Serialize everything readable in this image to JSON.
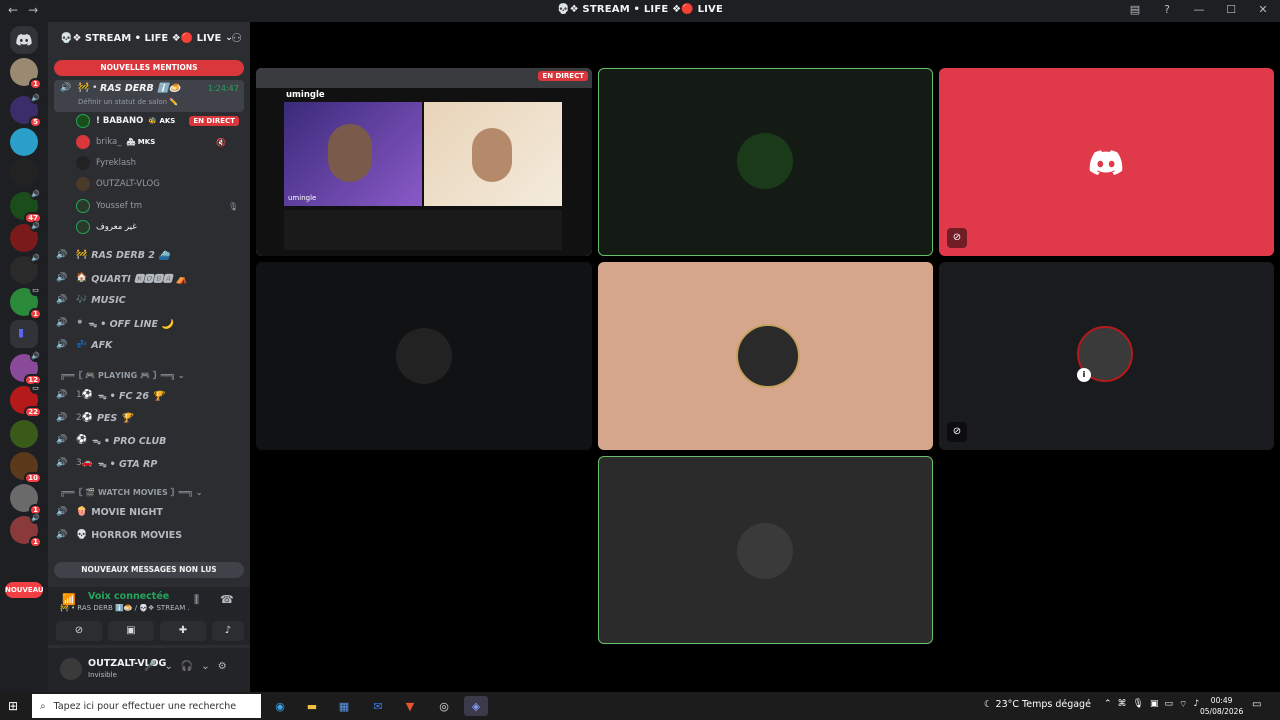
{
  "window": {
    "title": "💀❖ STREAM • LIFE ❖🔴 LIVE",
    "nav_back": "←",
    "nav_forward": "→",
    "inbox_icon": "inbox-icon",
    "help_icon": "help-icon"
  },
  "servers": [
    {
      "name": "home",
      "badge": ""
    },
    {
      "name": "server-1",
      "badge": "1"
    },
    {
      "name": "server-2",
      "badge": "5"
    },
    {
      "name": "server-3",
      "badge": ""
    },
    {
      "name": "server-4",
      "badge": ""
    },
    {
      "name": "server-5",
      "badge": "47"
    },
    {
      "name": "server-6",
      "badge": ""
    },
    {
      "name": "server-7",
      "badge": ""
    },
    {
      "name": "server-8",
      "badge": "1"
    },
    {
      "name": "folder",
      "badge": ""
    },
    {
      "name": "server-9",
      "badge": "12"
    },
    {
      "name": "server-10",
      "badge": "22"
    },
    {
      "name": "server-11",
      "badge": ""
    },
    {
      "name": "server-12",
      "badge": "10"
    },
    {
      "name": "server-13",
      "badge": "1"
    },
    {
      "name": "server-14",
      "badge": "1"
    }
  ],
  "new_pill": "NOUVEAU",
  "guild": {
    "name": "💀❖ STREAM • LIFE ❖🔴 LIVE",
    "mentions_pill": "NOUVELLES MENTIONS",
    "active_channel": {
      "name": "RAS DERB ℹ️🍮",
      "status": "Définir un statut de salon ✏️",
      "timer": "1:24:47"
    },
    "members": [
      {
        "name": "! BABANO",
        "tag": "🐝 AKS",
        "live": "EN DIRECT"
      },
      {
        "name": "brika_",
        "tag": "🏘 MKS",
        "live": ""
      },
      {
        "name": "Fyreklash",
        "tag": "",
        "live": ""
      },
      {
        "name": "OUTZALT-VLOG",
        "tag": "",
        "live": ""
      },
      {
        "name": "Youssef tm",
        "tag": "",
        "live": ""
      },
      {
        "name": "غير معروف",
        "tag": "",
        "live": ""
      }
    ],
    "channels": [
      {
        "emoji": "🚧",
        "name": "RAS DERB 2 ⛴️"
      },
      {
        "emoji": "🏠",
        "name": "QUARTI 🅺🅾🅱🅰 ⛺"
      },
      {
        "emoji": "🎶",
        "name": "MUSIC"
      },
      {
        "emoji": "⚫",
        "name": "ᯓ • OFF LINE 🌙"
      },
      {
        "emoji": "💤",
        "name": "AFK"
      }
    ],
    "cat_playing": "╔══〖 🎮 ΡLΑΥΙΝG 🎮 〗══╗ ⌄",
    "playing_channels": [
      {
        "emoji": "1⚽",
        "name": "ᯓ • FC 26 🏆"
      },
      {
        "emoji": "2⚽",
        "name": "PES 🏆"
      },
      {
        "emoji": "⚽",
        "name": "ᯓ • PRO CLUB"
      },
      {
        "emoji": "3🚗",
        "name": "ᯓ • GTA RP"
      }
    ],
    "cat_movies": "╔══〖 🎬 WATCH MOVIES 〗══╗ ⌄",
    "movie_channels": [
      {
        "emoji": "🍿",
        "name": "MOVIE NIGHT"
      },
      {
        "emoji": "💀",
        "name": "HORROR MOVIES"
      }
    ],
    "unread_pill": "NOUVEAUX MESSAGES NON LUS"
  },
  "voice": {
    "status": "Voix connectée",
    "channel": "🚧 • RAS DERB ℹ️🍮 / 💀❖ STREAM ..."
  },
  "user": {
    "name": "OUTZALT-VLOG",
    "status": "Invisible"
  },
  "stage": {
    "screen_share_live": "EN DIRECT",
    "screen_share_site": "umingle",
    "screen_share_caption": "umingle"
  },
  "taskbar": {
    "search_placeholder": "Tapez ici pour effectuer une recherche",
    "weather": "23°C  Temps dégagé",
    "time": "00:49",
    "date": "05/08/2026"
  },
  "colors": {
    "accent_red": "#da373c",
    "voice_green": "#23a55a",
    "speaking_border": "#6abf69",
    "discord_red_tile": "#e03a4a",
    "peach_tile": "#d5a68b"
  }
}
